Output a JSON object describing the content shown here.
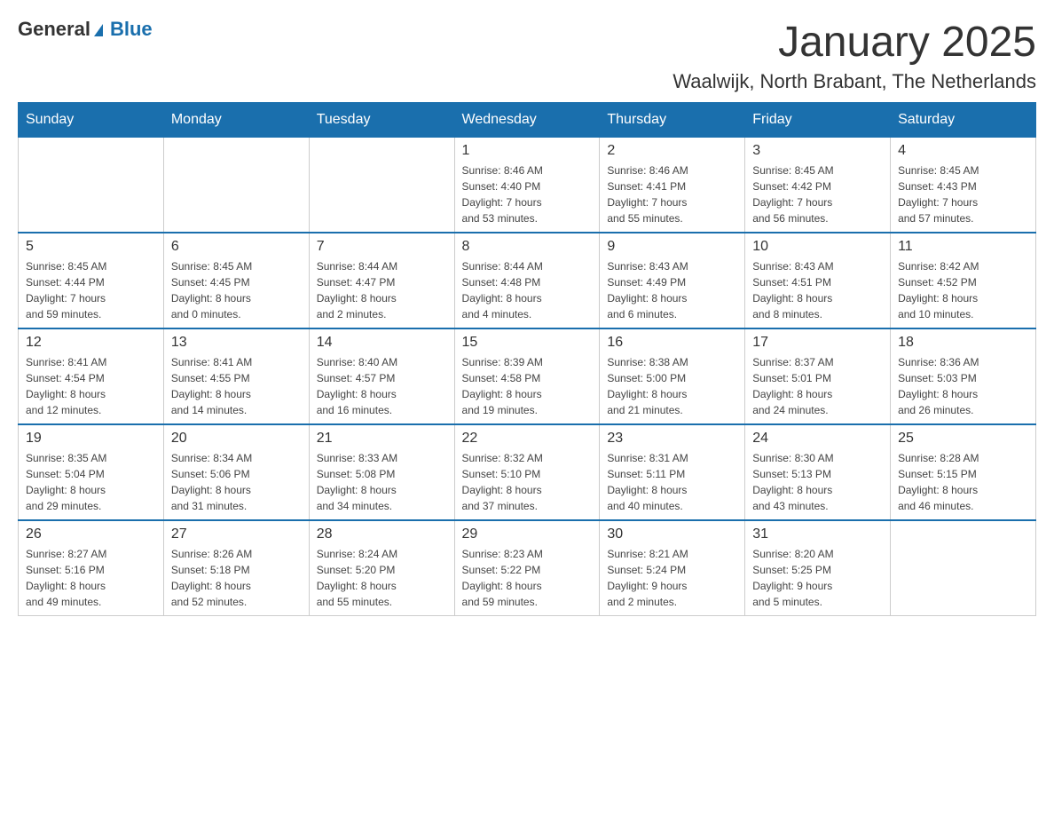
{
  "header": {
    "logo_general": "General",
    "logo_blue": "Blue",
    "month_title": "January 2025",
    "location": "Waalwijk, North Brabant, The Netherlands"
  },
  "weekdays": [
    "Sunday",
    "Monday",
    "Tuesday",
    "Wednesday",
    "Thursday",
    "Friday",
    "Saturday"
  ],
  "weeks": [
    [
      {
        "day": "",
        "info": ""
      },
      {
        "day": "",
        "info": ""
      },
      {
        "day": "",
        "info": ""
      },
      {
        "day": "1",
        "info": "Sunrise: 8:46 AM\nSunset: 4:40 PM\nDaylight: 7 hours\nand 53 minutes."
      },
      {
        "day": "2",
        "info": "Sunrise: 8:46 AM\nSunset: 4:41 PM\nDaylight: 7 hours\nand 55 minutes."
      },
      {
        "day": "3",
        "info": "Sunrise: 8:45 AM\nSunset: 4:42 PM\nDaylight: 7 hours\nand 56 minutes."
      },
      {
        "day": "4",
        "info": "Sunrise: 8:45 AM\nSunset: 4:43 PM\nDaylight: 7 hours\nand 57 minutes."
      }
    ],
    [
      {
        "day": "5",
        "info": "Sunrise: 8:45 AM\nSunset: 4:44 PM\nDaylight: 7 hours\nand 59 minutes."
      },
      {
        "day": "6",
        "info": "Sunrise: 8:45 AM\nSunset: 4:45 PM\nDaylight: 8 hours\nand 0 minutes."
      },
      {
        "day": "7",
        "info": "Sunrise: 8:44 AM\nSunset: 4:47 PM\nDaylight: 8 hours\nand 2 minutes."
      },
      {
        "day": "8",
        "info": "Sunrise: 8:44 AM\nSunset: 4:48 PM\nDaylight: 8 hours\nand 4 minutes."
      },
      {
        "day": "9",
        "info": "Sunrise: 8:43 AM\nSunset: 4:49 PM\nDaylight: 8 hours\nand 6 minutes."
      },
      {
        "day": "10",
        "info": "Sunrise: 8:43 AM\nSunset: 4:51 PM\nDaylight: 8 hours\nand 8 minutes."
      },
      {
        "day": "11",
        "info": "Sunrise: 8:42 AM\nSunset: 4:52 PM\nDaylight: 8 hours\nand 10 minutes."
      }
    ],
    [
      {
        "day": "12",
        "info": "Sunrise: 8:41 AM\nSunset: 4:54 PM\nDaylight: 8 hours\nand 12 minutes."
      },
      {
        "day": "13",
        "info": "Sunrise: 8:41 AM\nSunset: 4:55 PM\nDaylight: 8 hours\nand 14 minutes."
      },
      {
        "day": "14",
        "info": "Sunrise: 8:40 AM\nSunset: 4:57 PM\nDaylight: 8 hours\nand 16 minutes."
      },
      {
        "day": "15",
        "info": "Sunrise: 8:39 AM\nSunset: 4:58 PM\nDaylight: 8 hours\nand 19 minutes."
      },
      {
        "day": "16",
        "info": "Sunrise: 8:38 AM\nSunset: 5:00 PM\nDaylight: 8 hours\nand 21 minutes."
      },
      {
        "day": "17",
        "info": "Sunrise: 8:37 AM\nSunset: 5:01 PM\nDaylight: 8 hours\nand 24 minutes."
      },
      {
        "day": "18",
        "info": "Sunrise: 8:36 AM\nSunset: 5:03 PM\nDaylight: 8 hours\nand 26 minutes."
      }
    ],
    [
      {
        "day": "19",
        "info": "Sunrise: 8:35 AM\nSunset: 5:04 PM\nDaylight: 8 hours\nand 29 minutes."
      },
      {
        "day": "20",
        "info": "Sunrise: 8:34 AM\nSunset: 5:06 PM\nDaylight: 8 hours\nand 31 minutes."
      },
      {
        "day": "21",
        "info": "Sunrise: 8:33 AM\nSunset: 5:08 PM\nDaylight: 8 hours\nand 34 minutes."
      },
      {
        "day": "22",
        "info": "Sunrise: 8:32 AM\nSunset: 5:10 PM\nDaylight: 8 hours\nand 37 minutes."
      },
      {
        "day": "23",
        "info": "Sunrise: 8:31 AM\nSunset: 5:11 PM\nDaylight: 8 hours\nand 40 minutes."
      },
      {
        "day": "24",
        "info": "Sunrise: 8:30 AM\nSunset: 5:13 PM\nDaylight: 8 hours\nand 43 minutes."
      },
      {
        "day": "25",
        "info": "Sunrise: 8:28 AM\nSunset: 5:15 PM\nDaylight: 8 hours\nand 46 minutes."
      }
    ],
    [
      {
        "day": "26",
        "info": "Sunrise: 8:27 AM\nSunset: 5:16 PM\nDaylight: 8 hours\nand 49 minutes."
      },
      {
        "day": "27",
        "info": "Sunrise: 8:26 AM\nSunset: 5:18 PM\nDaylight: 8 hours\nand 52 minutes."
      },
      {
        "day": "28",
        "info": "Sunrise: 8:24 AM\nSunset: 5:20 PM\nDaylight: 8 hours\nand 55 minutes."
      },
      {
        "day": "29",
        "info": "Sunrise: 8:23 AM\nSunset: 5:22 PM\nDaylight: 8 hours\nand 59 minutes."
      },
      {
        "day": "30",
        "info": "Sunrise: 8:21 AM\nSunset: 5:24 PM\nDaylight: 9 hours\nand 2 minutes."
      },
      {
        "day": "31",
        "info": "Sunrise: 8:20 AM\nSunset: 5:25 PM\nDaylight: 9 hours\nand 5 minutes."
      },
      {
        "day": "",
        "info": ""
      }
    ]
  ]
}
